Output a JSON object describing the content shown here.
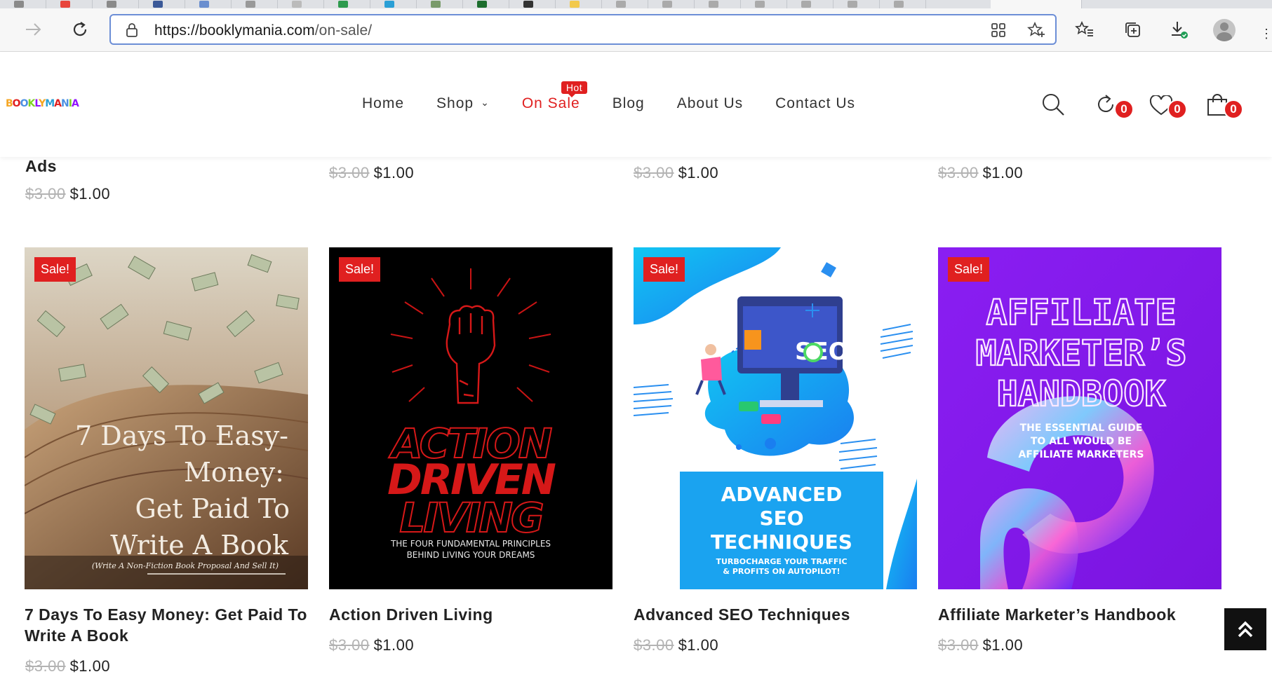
{
  "browser": {
    "url_host": "https://booklymania.com",
    "url_path": "/on-sale/"
  },
  "header": {
    "logo": "BOOKLYMANIA",
    "nav": [
      {
        "label": "Home"
      },
      {
        "label": "Shop"
      },
      {
        "label": "On Sale",
        "badge": "Hot"
      },
      {
        "label": "Blog"
      },
      {
        "label": "About Us"
      },
      {
        "label": "Contact Us"
      }
    ],
    "compare_count": "0",
    "wishlist_count": "0",
    "cart_count": "0"
  },
  "previous_row": {
    "first_title_tail": "Ads",
    "old_price": "$3.00",
    "new_price": "$1.00"
  },
  "products": [
    {
      "sale": "Sale!",
      "title": "7 Days To Easy Money: Get Paid To Write A Book",
      "old_price": "$3.00",
      "new_price": "$1.00",
      "cover_lines": [
        "7 Days To Easy-",
        "Money:",
        "Get Paid To",
        "Write A Book"
      ],
      "cover_sub": "(Write A Non-Fiction Book Proposal And Sell It)"
    },
    {
      "sale": "Sale!",
      "title": "Action Driven Living",
      "old_price": "$3.00",
      "new_price": "$1.00",
      "cover_lines": [
        "ACTION",
        "DRIVEN",
        "LIVING"
      ],
      "cover_sub1": "THE FOUR FUNDAMENTAL PRINCIPLES",
      "cover_sub2": "BEHIND LIVING YOUR DREAMS"
    },
    {
      "sale": "Sale!",
      "title": "Advanced SEO Techniques",
      "old_price": "$3.00",
      "new_price": "$1.00",
      "cover_lines": [
        "ADVANCED",
        "SEO",
        "TECHNIQUES"
      ],
      "cover_sub1": "TURBOCHARGE YOUR TRAFFIC",
      "cover_sub2": "& PROFITS ON AUTOPILOT!",
      "cover_screen": "SEO"
    },
    {
      "sale": "Sale!",
      "title": "Affiliate Marketer’s Handbook",
      "old_price": "$3.00",
      "new_price": "$1.00",
      "cover_lines": [
        "AFFILIATE",
        "MARKETER’S",
        "HANDBOOK"
      ],
      "cover_sub_lines": [
        "THE ESSENTIAL GUIDE",
        "TO ALL WOULD BE",
        "AFFILIATE MARKETERS"
      ]
    }
  ],
  "colors": {
    "accent": "#e02020",
    "address_border": "#6c8ed6",
    "cover2_bg": "#000000",
    "cover3_box": "#1aa3f0",
    "cover4_bg": "#8b1cf0"
  }
}
